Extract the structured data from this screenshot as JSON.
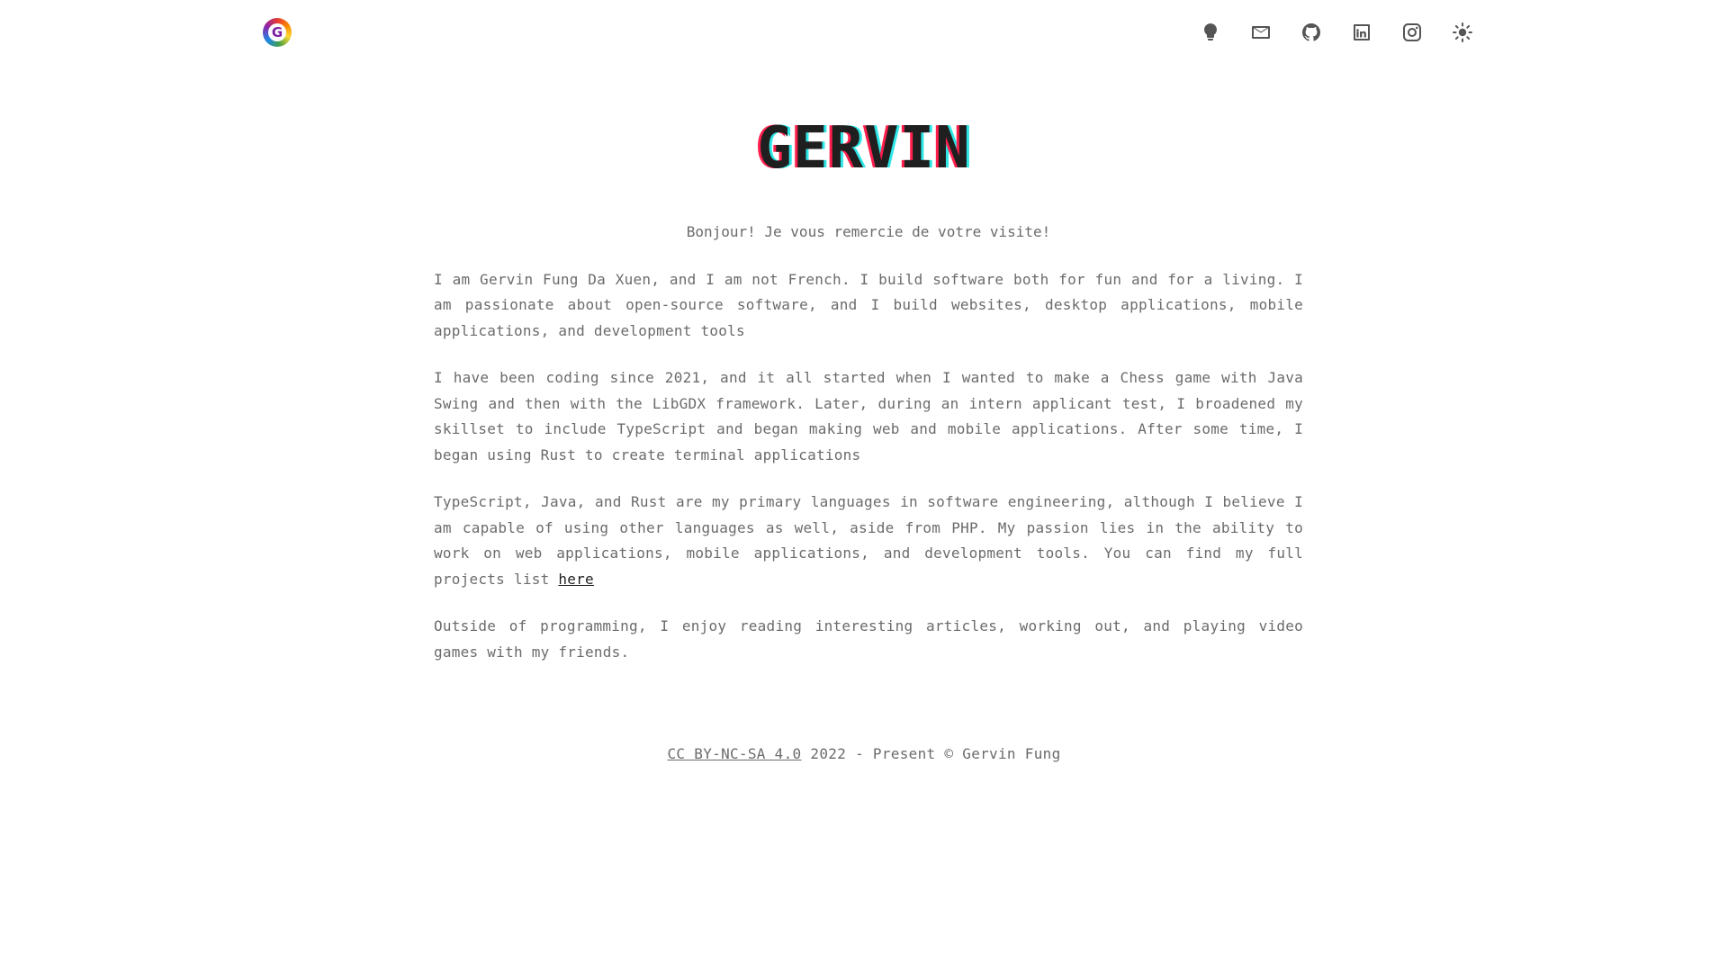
{
  "header": {
    "logo_letter": "G",
    "icons": [
      {
        "name": "lightbulb-icon"
      },
      {
        "name": "mail-icon"
      },
      {
        "name": "github-icon"
      },
      {
        "name": "linkedin-icon"
      },
      {
        "name": "instagram-icon"
      },
      {
        "name": "sun-icon"
      }
    ]
  },
  "title": "GERVIN",
  "greeting": "Bonjour! Je vous remercie de votre visite!",
  "paragraphs": {
    "p1": "I am Gervin Fung Da Xuen, and I am not French. I build software both for fun and for a living. I am passionate about open-source software, and I build websites, desktop applications, mobile applications, and development tools",
    "p2": "I have been coding since 2021, and it all started when I wanted to make a Chess game with Java Swing and then with the LibGDX framework. Later, during an intern applicant test, I broadened my skillset to include TypeScript and began making web and mobile applications. After some time, I began using Rust to create terminal applications",
    "p3": "TypeScript, Java, and Rust are my primary languages in software engineering, although I believe I am capable of using other languages as well, aside from PHP. My passion lies in the ability to work on web applications, mobile applications, and development tools. You can find my full projects list",
    "p3_link": "here",
    "p4": "Outside of programming, I enjoy reading interesting articles, working out, and playing video games with my friends."
  },
  "footer": {
    "license_link": "CC BY-NC-SA 4.0",
    "text": "2022 - Present © Gervin Fung"
  },
  "colors": {
    "text": "#6b6b6b",
    "title": "#1f1f1f",
    "glitch_red": "#ff1e4c",
    "glitch_cyan": "#2ee6e6"
  }
}
